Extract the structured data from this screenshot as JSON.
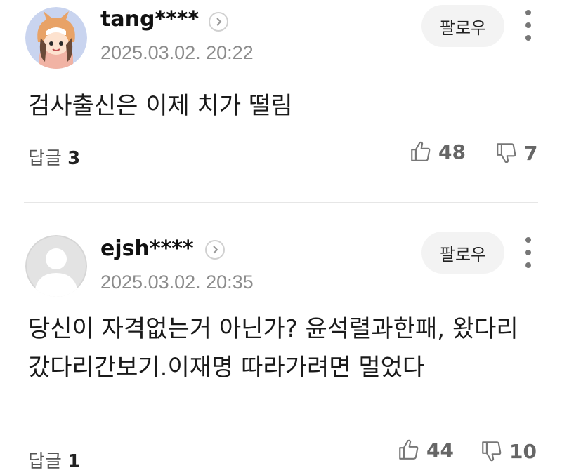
{
  "comments": [
    {
      "username": "tang****",
      "timestamp": "2025.03.02. 20:22",
      "follow_label": "팔로우",
      "text": "검사출신은 이제 치가 떨림",
      "reply_label": "답글",
      "reply_count": "3",
      "likes": "48",
      "dislikes": "7",
      "avatar": "cartoon-character-avatar"
    },
    {
      "username": "ejsh****",
      "timestamp": "2025.03.02. 20:35",
      "follow_label": "팔로우",
      "text": "당신이 자격없는거 아닌가? 윤석렬과한패, 왔다리갔다리간보기.이재명 따라가려면 멀었다",
      "reply_label": "답글",
      "reply_count": "1",
      "likes": "44",
      "dislikes": "10",
      "avatar": "default-user-avatar"
    }
  ],
  "colors": {
    "text": "#1a1a1a",
    "muted": "#8c8c8c",
    "button_bg": "#f3f3f3",
    "divider": "#e6e6e6"
  }
}
